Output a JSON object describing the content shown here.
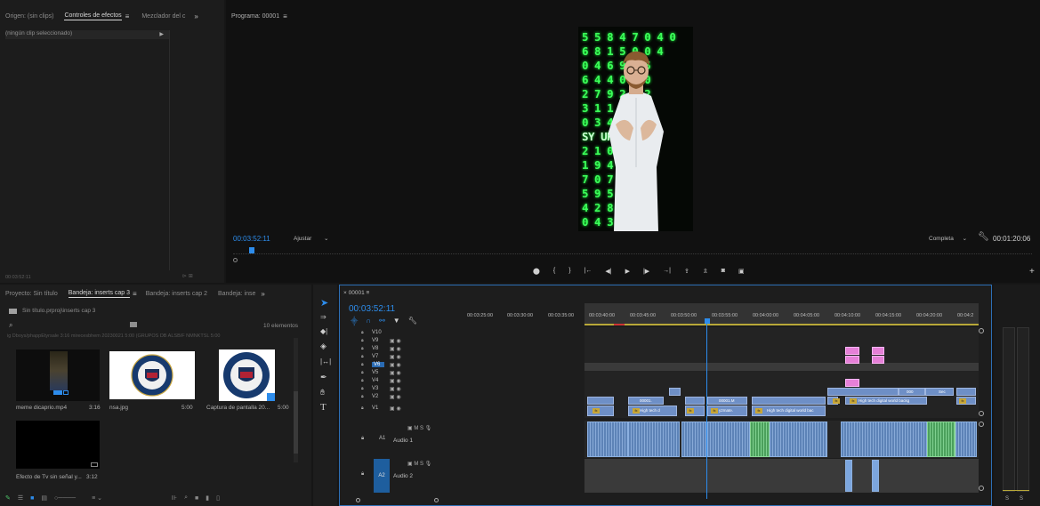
{
  "source_panel": {
    "tabs": [
      "Origen: (sin clips)",
      "Controles de efectos",
      "Mezclador del c"
    ],
    "active_tab": "Controles de efectos",
    "no_clip_label": "(ningún clip seleccionado)",
    "timecode": "00:03:52:11"
  },
  "program_monitor": {
    "tab": "Programa: 00001",
    "timecode": "00:03:52:11",
    "fit_label": "Ajustar",
    "resolution_label": "Completa",
    "duration": "00:01:20:06",
    "matrix_rows": [
      "5 5 8 4 7 0 4 0",
      "6 8 1 5 0 0 4",
      "0 4 6 9 4 5",
      "6 4 4 0 4 0",
      "2 7 9 2 7 2",
      "3 1 1 5",
      "0 3 4 7",
      "SY UR",
      "2 1 0",
      "1 9 4",
      "7 0 7 9",
      "5 9 5 3",
      "4 2 8 8",
      "0 4 3 3"
    ]
  },
  "project_panel": {
    "tabs": [
      "Proyecto: Sin título",
      "Bandeja: inserts cap 3",
      "Bandeja: inserts cap 2",
      "Bandeja: inse"
    ],
    "active_tab": "Bandeja: inserts cap 3",
    "path": "Sin título.prproj\\inserts cap 3",
    "item_count": "10 elementos",
    "cut_row": "ig Dboys/phappEtyrsale   3:16    mirecesbhem 20230021   5:00    (GRUPOS DB ALSB/F NMNKTSL  5:00",
    "items": [
      {
        "name": "meme dicaprio.mp4",
        "duration": "3:16"
      },
      {
        "name": "nsa.jpg",
        "duration": "5:00"
      },
      {
        "name": "Captura de pantalla 20...",
        "duration": "5:00"
      },
      {
        "name": "Efecto de Tv sin señal y...",
        "duration": "3:12"
      }
    ]
  },
  "timeline": {
    "sequence_tab": "00001",
    "timecode": "00:03:52:11",
    "ruler": [
      "00:03:25:00",
      "00:03:30:00",
      "00:03:35:00",
      "00:03:40:00",
      "00:03:45:00",
      "00:03:50:00",
      "00:03:55:00",
      "00:04:00:00",
      "00:04:05:00",
      "00:04:10:00",
      "00:04:15:00",
      "00:04:20:00",
      "00:04:2"
    ],
    "video_tracks": [
      "V10",
      "V9",
      "V8",
      "V7",
      "V6",
      "V5",
      "V4",
      "V3",
      "V2",
      "V1"
    ],
    "audio_tracks": [
      {
        "id": "A1",
        "name": "Audio 1"
      },
      {
        "id": "A2",
        "name": "Audio 2"
      }
    ],
    "clip_labels": {
      "c1": "00001.",
      "c1b": "High tech d",
      "c2": "00001.M",
      "c2b": "y2mate.",
      "c3": "High tech digital world bac",
      "c4": "High tech digital world backg",
      "c5": "000",
      "c6": "Sec"
    }
  },
  "audio_meter": {
    "labels": [
      "S",
      "S"
    ]
  },
  "colors": {
    "accent": "#2d8ceb",
    "video_clip": "#6e8fc6",
    "graphic_clip": "#e680d8",
    "audio_clip": "#5d83b7",
    "green_clip": "#4ba05c",
    "matrix_green": "#3cff5a"
  }
}
